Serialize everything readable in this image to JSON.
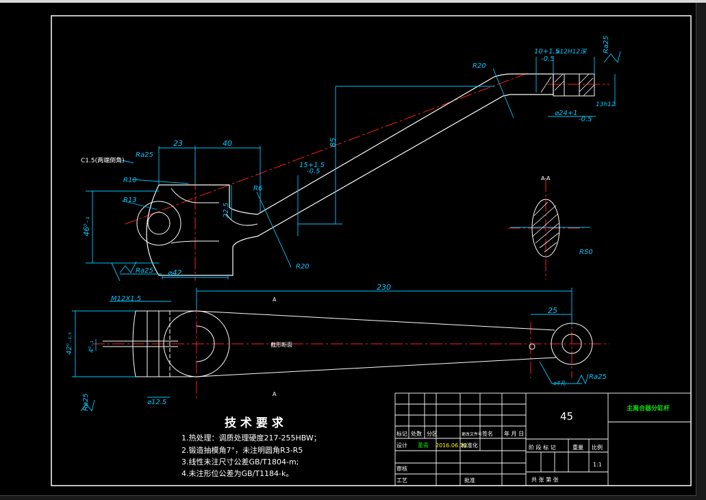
{
  "drawing": {
    "dims": {
      "d23": "23",
      "d40": "40",
      "d85": "85",
      "d230": "230",
      "d25": "25",
      "d46": "46⁰₋₁",
      "d42": "⌀42",
      "d225": "22.5",
      "tol_top": "10+1.5",
      "tol_top2": "-0.5",
      "tol_mid": "15+1.5",
      "tol_mid2": "-0.5",
      "h12": "⌀12H12深",
      "h13": "13h12",
      "d24": "⌀24+1",
      "d24b": "-0.5",
      "m12": "M12X1.5",
      "d125": "⌀12.5",
      "d42b": "42⁰₋₁.₅",
      "d4": "4⁰₋₁",
      "d4hole": "⌀4孔"
    },
    "radii": {
      "r20a": "R20",
      "r20b": "R20",
      "r10": "R10",
      "r13": "R13",
      "r6": "R6",
      "r50": "R50"
    },
    "roughness": {
      "ra1": "Ra25",
      "ra2": "Ra25",
      "ra3": "Ra25",
      "ra4": "Ra25",
      "ra5": "Ra25"
    },
    "chamfer": "C1.5(两端倒角)",
    "section_label": "A-A",
    "section_a1": "A",
    "section_a2": "A",
    "center_label": "截形断面"
  },
  "tech_requirements": {
    "title": "技 术 要 求",
    "items": [
      "1.热处理：调质处理硬度217-255HBW；",
      "2.锻造抽模角7°，未注明圆角R3-R5",
      "3.线性未注尺寸公差GB/T1804-m;",
      "4.未注形位公差为GB/T1184-k。"
    ]
  },
  "title_block": {
    "material": "45",
    "part_name": "主离合器分缸杆",
    "h_biaoji": "标记",
    "h_chushu": "处数",
    "h_fenqu": "分区",
    "h_wenjian": "更改文件号",
    "h_qianming": "签名",
    "h_nianyueri": "年 月 日",
    "r_sheji": "设计",
    "designer": "董青",
    "date": "2016.06.10",
    "r_biaozhunhua": "标准化",
    "r_jieduan": "阶 段 标 记",
    "r_zhongliang": "重量",
    "r_bili": "比例",
    "scale": "1:1",
    "r_shenhe": "审核",
    "r_gongyi": "工艺",
    "r_pizhun": "批准",
    "sheets": "共   张  第   张"
  }
}
